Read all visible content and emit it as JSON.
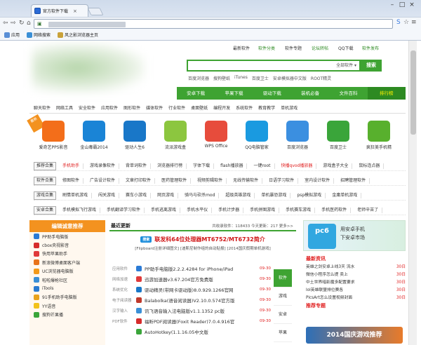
{
  "browser": {
    "tab_title": "官方软件下载",
    "bookmarks": [
      "应用",
      "网络搜索",
      "风之影浏览器主页"
    ]
  },
  "header": {
    "top_links": [
      "最新软件",
      "软件分类",
      "软件专题",
      "论坛转帖",
      "QQ下载",
      "软件发布"
    ],
    "search_select": "全部软件",
    "search_button": "搜索",
    "hot_words": [
      "百度浏览器",
      "搜狗壁纸",
      "iTunes",
      "百度卫士",
      "安卓模拟器中文版",
      "ROOT精灵"
    ]
  },
  "main_nav": [
    "安卓下载",
    "苹果下载",
    "驱动下载",
    "装机必备",
    "文件百科",
    "排行榜"
  ],
  "sub_nav": [
    "聊天软件",
    "网络工具",
    "安全软件",
    "应用软件",
    "图形软件",
    "媒体软件",
    "行业软件",
    "桌面壁纸",
    "编程开发",
    "系统软件",
    "教育教学",
    "单机游戏"
  ],
  "apps": {
    "new_tag": "最新",
    "items": [
      {
        "label": "爱奇艺PPS影音",
        "color": "#f36e1a"
      },
      {
        "label": "金山毒霸2014",
        "color": "#1a84d6"
      },
      {
        "label": "驱动人生6",
        "color": "#1977c8"
      },
      {
        "label": "流派游戏盒",
        "color": "#8cc63f"
      },
      {
        "label": "WPS Office",
        "color": "#e74c3c"
      },
      {
        "label": "QQ电脑管家",
        "color": "#1a9ae0"
      },
      {
        "label": "百度浏览器",
        "color": "#3b8fe0"
      },
      {
        "label": "百度卫士",
        "color": "#3aa53a"
      },
      {
        "label": "疯狂美手机精",
        "color": "#58b02d"
      }
    ]
  },
  "categories": [
    {
      "label": "推荐合集",
      "items": [
        "手机助手",
        "游戏录像软件",
        "背单词软件",
        "浏览器排行榜",
        "字体下载",
        "flash播放器",
        "一键root",
        "快播qvod播放器",
        "游戏盒子大全",
        "鼠标连点器"
      ],
      "red": [
        0,
        7
      ]
    },
    {
      "label": "软件合集",
      "items": [
        "修图软件",
        "广告设计软件",
        "文章打印软件",
        "医药管理软件",
        "视频剪辑软件",
        "无线传输软件",
        "日语学习软件",
        "室内设计软件",
        "招聘管理软件"
      ],
      "red": []
    },
    {
      "label": "游戏合集",
      "items": [
        "刷情单机游戏",
        "闯关游戏",
        "赛车小游戏",
        "网页游戏",
        "骑马与砍杀mod",
        "超级英雄游戏",
        "单机暴恐游戏",
        "psp模拟游戏",
        "金庸单机游戏"
      ],
      "red": []
    },
    {
      "label": "安卓合集",
      "items": [
        "手机模拟飞行游戏",
        "手机翻译学习软件",
        "手机逃离游戏",
        "手机水平仪",
        "手机计步器",
        "手机拼图游戏",
        "手机赛车游戏",
        "手机医药软件",
        "老师辛苦了"
      ],
      "red": []
    }
  ],
  "left_panel": {
    "title": "编辑诚意推荐",
    "items": [
      {
        "label": "PP助手电脑版",
        "color": "#2b7bd6"
      },
      {
        "label": "cbox央视影音",
        "color": "#d62b2b"
      },
      {
        "label": "快用苹果助手",
        "color": "#e03a3a"
      },
      {
        "label": "新浪微博桌面客户端",
        "color": "#e8731a"
      },
      {
        "label": "UC浏览器电脑版",
        "color": "#f39a1a"
      },
      {
        "label": "啦啦爆枪社区",
        "color": "#3a8fd6"
      },
      {
        "label": "iTools",
        "color": "#2a7bd0"
      },
      {
        "label": "91手机助手电脑版",
        "color": "#e8a21a"
      },
      {
        "label": "YY语音",
        "color": "#f2c21a"
      },
      {
        "label": "搜狗芒果播",
        "color": "#3aa53a"
      }
    ]
  },
  "latest": {
    "title": "最近更新",
    "stats": "共收录软件：118433 今天更新：217 更多>>",
    "headline_tag": "搜索",
    "headline": "联发科64位处理器MT6752/MT6732简介",
    "subline": "[Flipboard注册详细图文] [迪斯尼制作组的自动贴报] [2014国庆假期单机游戏]",
    "rows": [
      {
        "cat": "应用软件",
        "text": "PP助手电脑版2.2.2.4284 for iPhone/iPad",
        "date": "09-30",
        "color": "#2b7bd6"
      },
      {
        "cat": "网络加速",
        "text": "迅游加速器v3.67.204官方免费版",
        "date": "09-30",
        "color": "#e03a3a"
      },
      {
        "cat": "系统优化",
        "text": "驱动精灵(带网卡驱动版)8.0.929.1266官网",
        "date": "09-30",
        "color": "#1977c8"
      },
      {
        "cat": "电子阅读器",
        "text": "Balabolka(语音阅读器)V2.10.0.574官方版",
        "date": "09-30",
        "color": "#c0392b"
      },
      {
        "cat": "汉字输入",
        "text": "讯飞语音输入法电脑版v1.1.1352 pc版",
        "date": "09-30",
        "color": "#3a8fd6"
      },
      {
        "cat": "PDF软件",
        "text": "福昕PDF阅读器(Foxit Reader)7.0.4.916官",
        "date": "09-30",
        "color": "#d62b2b"
      },
      {
        "cat": "",
        "text": "AutoHotkey(1.1.16.05中文版",
        "date": "",
        "color": "#3aa53a"
      }
    ],
    "side_tabs": [
      "软件",
      "游戏",
      "安卓",
      "苹果"
    ]
  },
  "right_panel": {
    "banner_logo": "pc6",
    "banner_lines": [
      "用安卓手机",
      "下安卓市场"
    ],
    "news_title": "最新资讯",
    "news": [
      {
        "text": "英雄之剑安卓上线3天 流水",
        "day": "30日"
      },
      {
        "text": "微信小程序怎么提 卖上",
        "day": "30日"
      },
      {
        "text": "中土世界暗影魔多配置要求",
        "day": "30日"
      },
      {
        "text": "lol英雄联盟排位赛各",
        "day": "30日"
      },
      {
        "text": "PicsArt怎么设置视频封面",
        "day": "30日"
      }
    ],
    "recommend_title": "推荐专题",
    "game_banner": "2014国庆游戏推荐"
  }
}
